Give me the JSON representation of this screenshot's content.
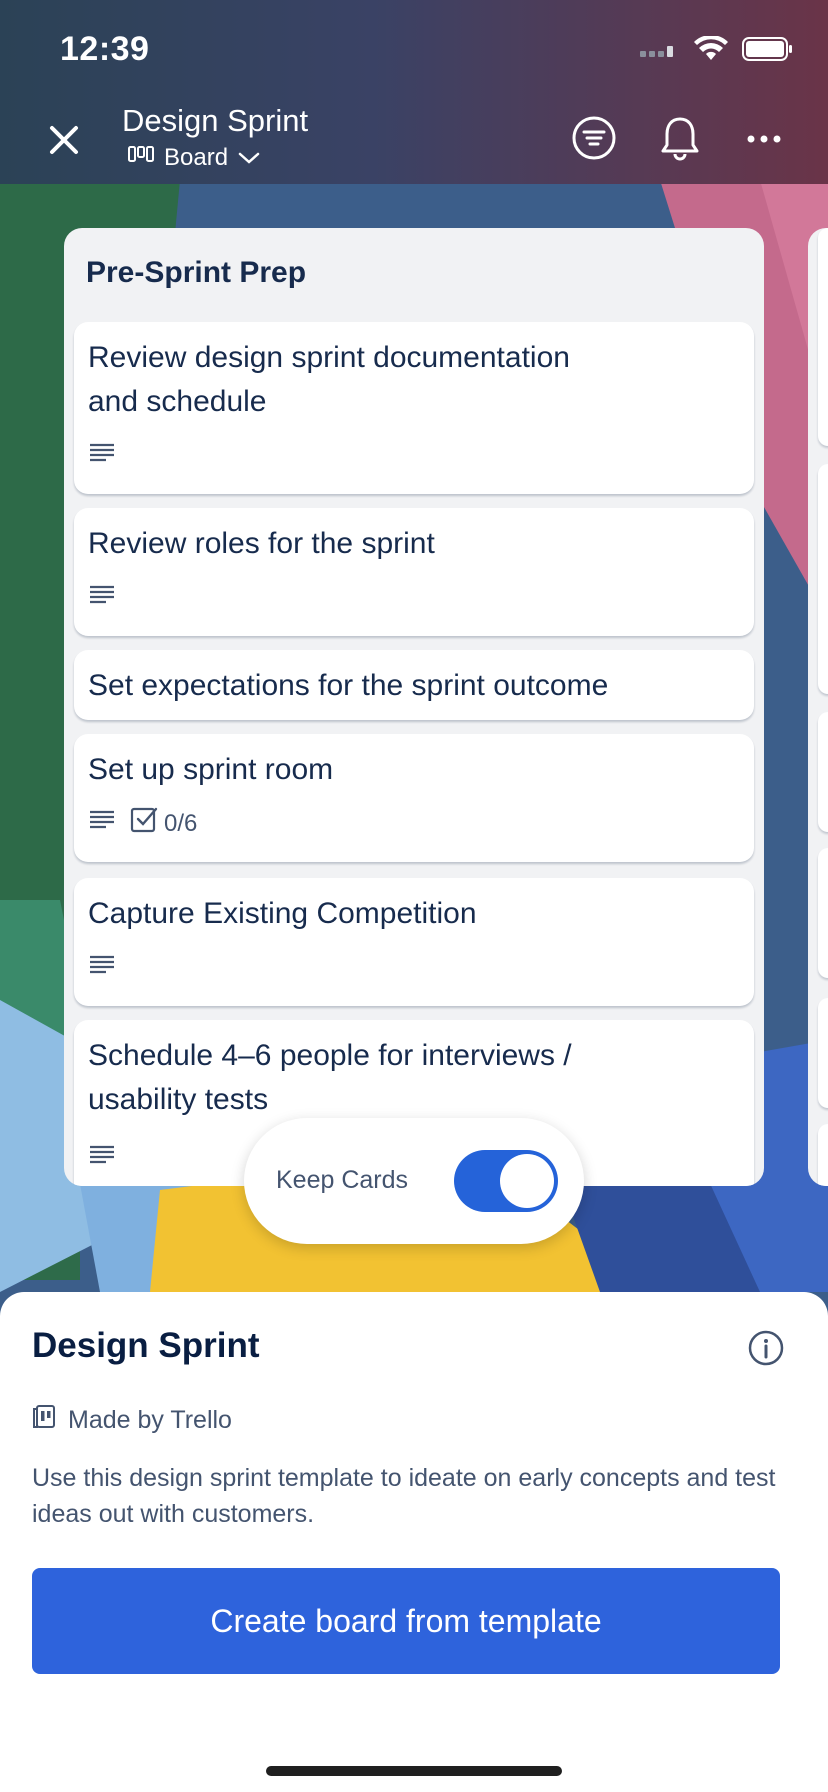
{
  "status_bar": {
    "time": "12:39"
  },
  "header": {
    "board_title": "Design Sprint",
    "view_label": "Board"
  },
  "list": {
    "title": "Pre-Sprint Prep",
    "cards": [
      {
        "title": "Review design sprint documentation and schedule",
        "has_description": true
      },
      {
        "title": "Review roles for the sprint",
        "has_description": true
      },
      {
        "title": "Set expectations for the sprint outcome",
        "has_description": false
      },
      {
        "title": "Set up sprint room",
        "has_description": true,
        "checklist": "0/6"
      },
      {
        "title": "Capture Existing Competition",
        "has_description": true
      },
      {
        "title": "Schedule 4–6 people for interviews / usability tests",
        "has_description": true
      }
    ]
  },
  "keep_cards": {
    "label": "Keep Cards",
    "enabled": true
  },
  "template_sheet": {
    "title": "Design Sprint",
    "made_by": "Made by Trello",
    "description": "Use this design sprint template to ideate on early concepts and test ideas out with customers.",
    "create_button": "Create board from template"
  },
  "icons": {
    "close": "close-icon",
    "board_view": "board-view-icon",
    "chevron": "chevron-down-icon",
    "filter": "filter-icon",
    "notifications": "bell-icon",
    "more": "more-icon",
    "description": "description-icon",
    "checklist": "checklist-icon",
    "info": "info-icon",
    "template": "template-icon"
  },
  "colors": {
    "primary_button": "#2e63dc",
    "toggle_on": "#2563d9",
    "list_bg": "#f1f2f4",
    "text_dark": "#172b4d"
  }
}
